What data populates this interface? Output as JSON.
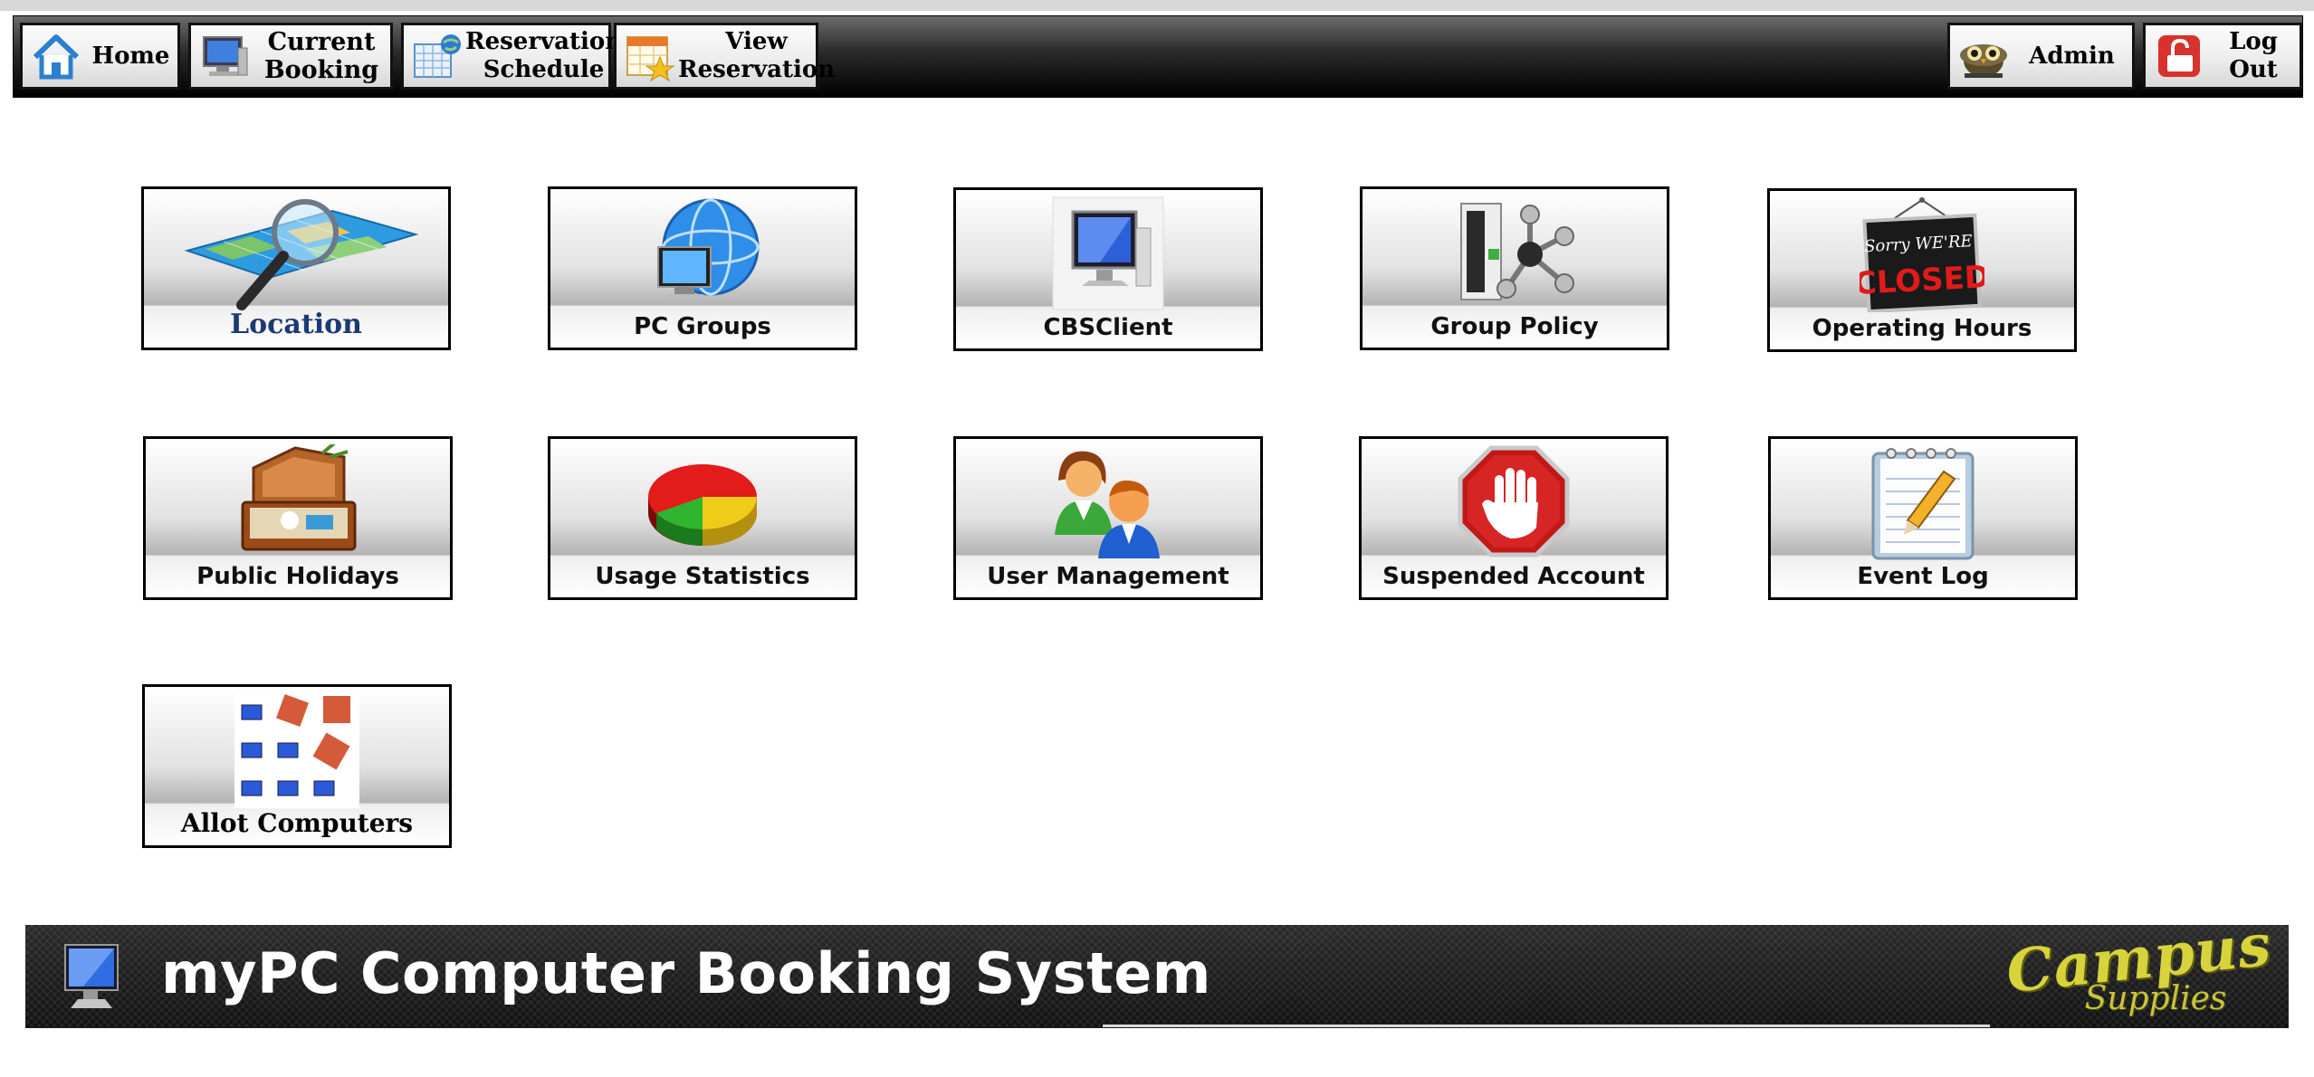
{
  "toolbar": {
    "home": "Home",
    "current_booking": "Current Booking",
    "reservation_schedule": "Reservation Schedule",
    "view_reservation": "View Reservation",
    "admin": "Admin",
    "logout": "Log Out"
  },
  "tiles": {
    "location": "Location",
    "pc_groups": "PC Groups",
    "cbsclient": "CBSClient",
    "group_policy": "Group Policy",
    "operating_hours": "Operating Hours",
    "public_holidays": "Public Holidays",
    "usage_statistics": "Usage Statistics",
    "user_management": "User Management",
    "suspended_account": "Suspended Account",
    "event_log": "Event Log",
    "allot_computers": "Allot Computers"
  },
  "sign": {
    "line1": "Sorry WE'RE",
    "line2": "CLOSED"
  },
  "footer": {
    "title": "myPC Computer Booking System",
    "logo_line1": "Campus",
    "logo_line2": "Supplies"
  },
  "icons": {
    "home": "house-icon",
    "current_booking": "computer-icon",
    "reservation_schedule": "calendar-globe-icon",
    "view_reservation": "calendar-star-icon",
    "admin": "owl-icon",
    "logout": "lock-icon"
  },
  "colors": {
    "toolbar_dark": "#000000",
    "tile_border": "#000000",
    "footer_bg": "#1a1a1a",
    "logo_yellow": "#d7d33c",
    "location_label": "#1b3a73"
  }
}
